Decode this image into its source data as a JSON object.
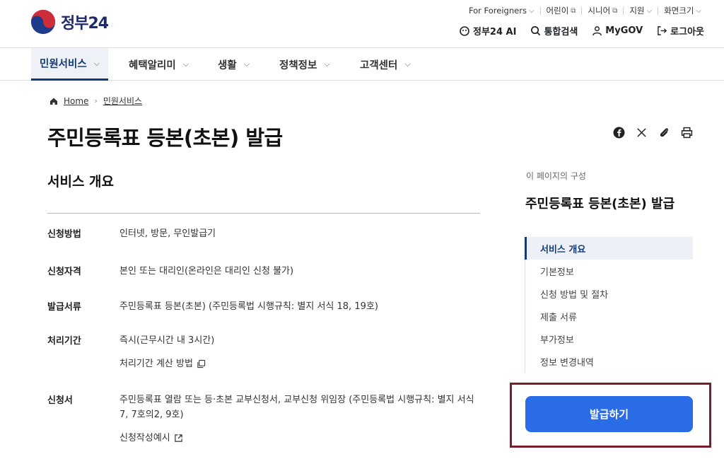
{
  "header": {
    "logo_text": "정부24",
    "util": [
      {
        "label": "For Foreigners",
        "icon": "chevron-down-icon"
      },
      {
        "label": "어린이",
        "icon": "external-link-icon"
      },
      {
        "label": "시니어",
        "icon": "external-link-icon"
      },
      {
        "label": "지원",
        "icon": "chevron-down-icon"
      },
      {
        "label": "화면크기",
        "icon": "chevron-down-icon"
      }
    ],
    "actions": [
      {
        "label": "정부24 AI",
        "icon": "ai-icon"
      },
      {
        "label": "통합검색",
        "icon": "search-icon"
      },
      {
        "label": "MyGOV",
        "icon": "user-icon"
      },
      {
        "label": "로그아웃",
        "icon": "logout-icon"
      }
    ]
  },
  "nav": {
    "items": [
      {
        "label": "민원서비스",
        "active": true
      },
      {
        "label": "혜택알리미"
      },
      {
        "label": "생활"
      },
      {
        "label": "정책정보"
      },
      {
        "label": "고객센터"
      }
    ]
  },
  "breadcrumb": {
    "home": "Home",
    "current": "민원서비스"
  },
  "page_title": "주민등록표 등본(초본) 발급",
  "section_title": "서비스 개요",
  "info_rows": [
    {
      "label": "신청방법",
      "value": "인터넷, 방문, 무인발급기"
    },
    {
      "label": "신청자격",
      "value": "본인 또는 대리인(온라인은 대리인 신청 불가)"
    },
    {
      "label": "발급서류",
      "value": "주민등록표 등본(초본) (주민등록법 시행규칙: 별지 서식 18, 19호)"
    },
    {
      "label": "처리기간",
      "value": "즉시(근무시간 내 3시간)",
      "link": "처리기간 계산 방법"
    },
    {
      "label": "신청서",
      "value": "주민등록표 열람 또는 등·초본 교부신청서, 교부신청 위임장 (주민등록법 시행규칙: 별지 서식 7, 7호의2, 9호)",
      "link": "신청작성예시"
    }
  ],
  "toc": {
    "caption": "이 페이지의 구성",
    "title": "주민등록표 등본(초본) 발급",
    "items": [
      "서비스 개요",
      "기본정보",
      "신청 방법 및 절차",
      "제출 서류",
      "부가정보",
      "정보 변경내역"
    ]
  },
  "issue_button": "발급하기",
  "colors": {
    "brand": "#123a78",
    "button": "#2a6be8",
    "highlight_border": "#7a1e2e"
  }
}
